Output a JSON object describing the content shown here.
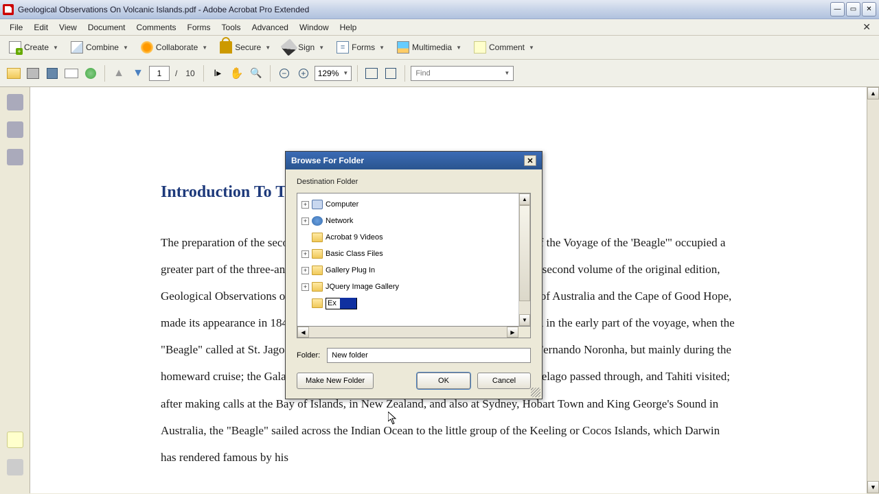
{
  "window": {
    "title": "Geological Observations On Volcanic Islands.pdf - Adobe Acrobat Pro Extended"
  },
  "menubar": {
    "items": [
      "File",
      "Edit",
      "View",
      "Document",
      "Comments",
      "Forms",
      "Tools",
      "Advanced",
      "Window",
      "Help"
    ]
  },
  "toolbar1": {
    "create": "Create",
    "combine": "Combine",
    "collaborate": "Collaborate",
    "secure": "Secure",
    "sign": "Sign",
    "forms": "Forms",
    "multimedia": "Multimedia",
    "comment": "Comment"
  },
  "toolbar2": {
    "page_current": "1",
    "page_sep": "/",
    "page_total": "10",
    "zoom": "129%",
    "find_placeholder": "Find"
  },
  "document": {
    "heading": "Introduction To The Second Edition",
    "body": "The preparation of the second edition of my work on the general title \"Geology of the Voyage of the 'Beagle'\" occupied a greater part of the three-and-a-half years that followed his return to England. The second volume of the original edition, Geological Observations on Volcanic Islands, with Brief Notices on the Geology of Australia and the Cape of Good Hope, made its appearance in 1844. The materials for this volume were chiefly collected in the early part of the voyage, when the \"Beagle\" called at St. Jago in the Cape de Verde Archipelago, The Abrolhos and Fernando Noronha, but mainly during the homeward cruise; the Galapagos Archipelago was then surveyed, the Low Archipelago passed through, and Tahiti visited; after making calls at the Bay of Islands, in New Zealand, and also at Sydney, Hobart Town and King George's Sound in Australia, the \"Beagle\" sailed across the Indian Ocean to the little group of the Keeling or Cocos Islands, which Darwin has rendered famous by his"
  },
  "dialog": {
    "title": "Browse For Folder",
    "destination_label": "Destination Folder",
    "tree": [
      {
        "expandable": true,
        "icon": "computer",
        "label": "Computer"
      },
      {
        "expandable": true,
        "icon": "network",
        "label": "Network"
      },
      {
        "expandable": false,
        "icon": "folder",
        "label": "Acrobat 9 Videos"
      },
      {
        "expandable": true,
        "icon": "folder",
        "label": "Basic Class Files"
      },
      {
        "expandable": true,
        "icon": "folder",
        "label": "Gallery Plug In"
      },
      {
        "expandable": true,
        "icon": "folder",
        "label": "JQuery Image Gallery"
      }
    ],
    "rename_value": "Ex",
    "folder_label": "Folder:",
    "folder_value": "New folder",
    "make_new": "Make New Folder",
    "ok": "OK",
    "cancel": "Cancel"
  }
}
